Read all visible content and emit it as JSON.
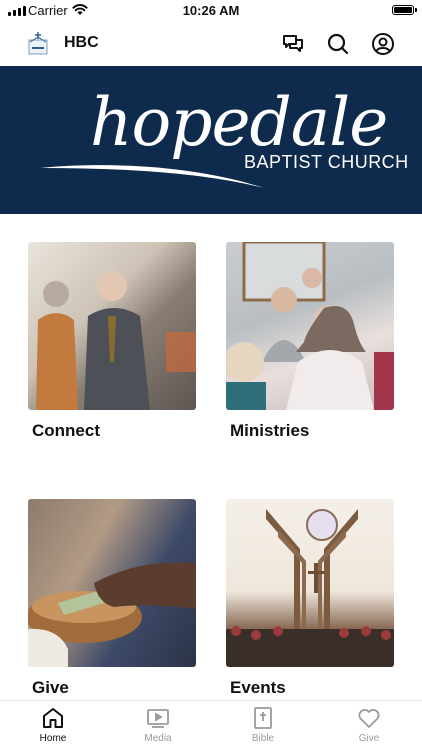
{
  "status_bar": {
    "carrier": "Carrier",
    "time": "10:26 AM"
  },
  "header": {
    "title": "HBC"
  },
  "banner": {
    "wordmark": "hopedale",
    "subtitle": "BAPTIST CHURCH",
    "background": "#0e2a4c"
  },
  "tiles": [
    {
      "label": "Connect"
    },
    {
      "label": "Ministries"
    },
    {
      "label": "Give"
    },
    {
      "label": "Events"
    }
  ],
  "tabbar": {
    "items": [
      {
        "label": "Home",
        "icon": "home-icon",
        "active": true
      },
      {
        "label": "Media",
        "icon": "play-icon",
        "active": false
      },
      {
        "label": "Bible",
        "icon": "bible-icon",
        "active": false
      },
      {
        "label": "Give",
        "icon": "heart-icon",
        "active": false
      }
    ]
  }
}
